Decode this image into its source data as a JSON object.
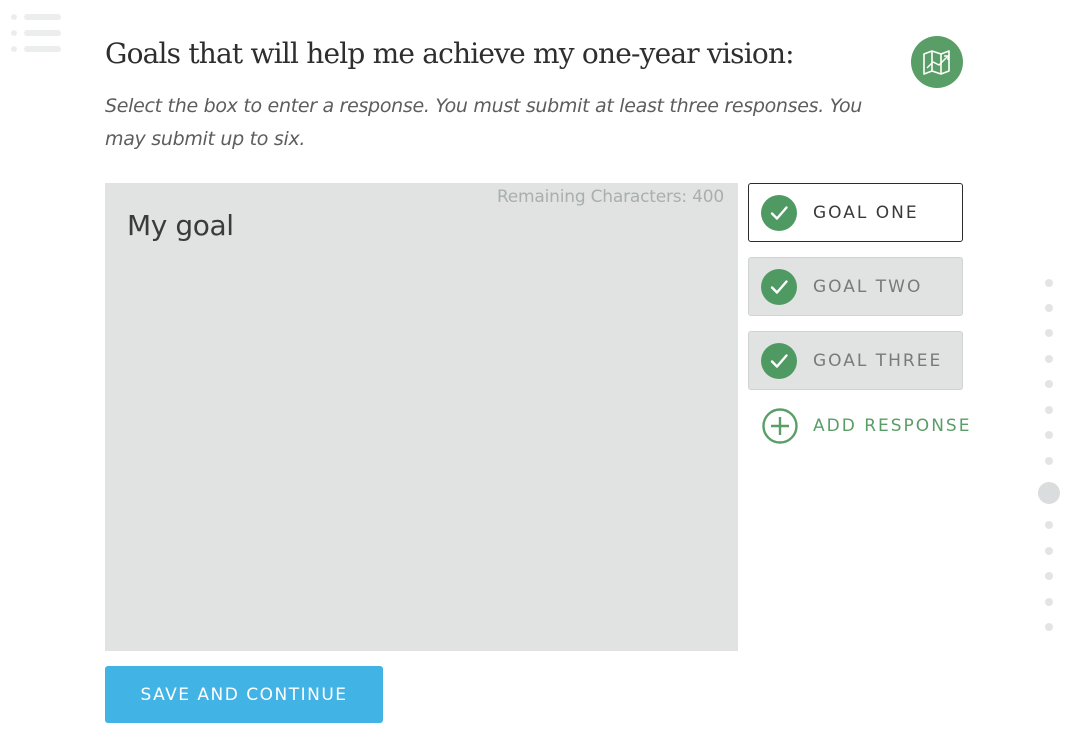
{
  "menu": {
    "icon": "list-menu-icon"
  },
  "header": {
    "title": "Goals that will help me achieve my one-year vision:",
    "map_icon": "map-icon"
  },
  "instructions": "Select the box to enter a response. You must submit at least three responses. You may submit up to six.",
  "response": {
    "counter": "Remaining Characters: 400",
    "text": "My goal"
  },
  "goals": [
    {
      "label": "GOAL ONE",
      "completed": true,
      "active": true
    },
    {
      "label": "GOAL TWO",
      "completed": true,
      "active": false
    },
    {
      "label": "GOAL THREE",
      "completed": true,
      "active": false
    }
  ],
  "add_response": {
    "label": "ADD RESPONSE",
    "icon": "plus-circle-icon"
  },
  "save_button": {
    "label": "SAVE AND CONTINUE"
  },
  "step_nav": {
    "total": 14,
    "current": 9
  },
  "colors": {
    "accent_green": "#5a9e67",
    "button_blue": "#42b3e5",
    "panel_gray": "#e0e3e2"
  }
}
